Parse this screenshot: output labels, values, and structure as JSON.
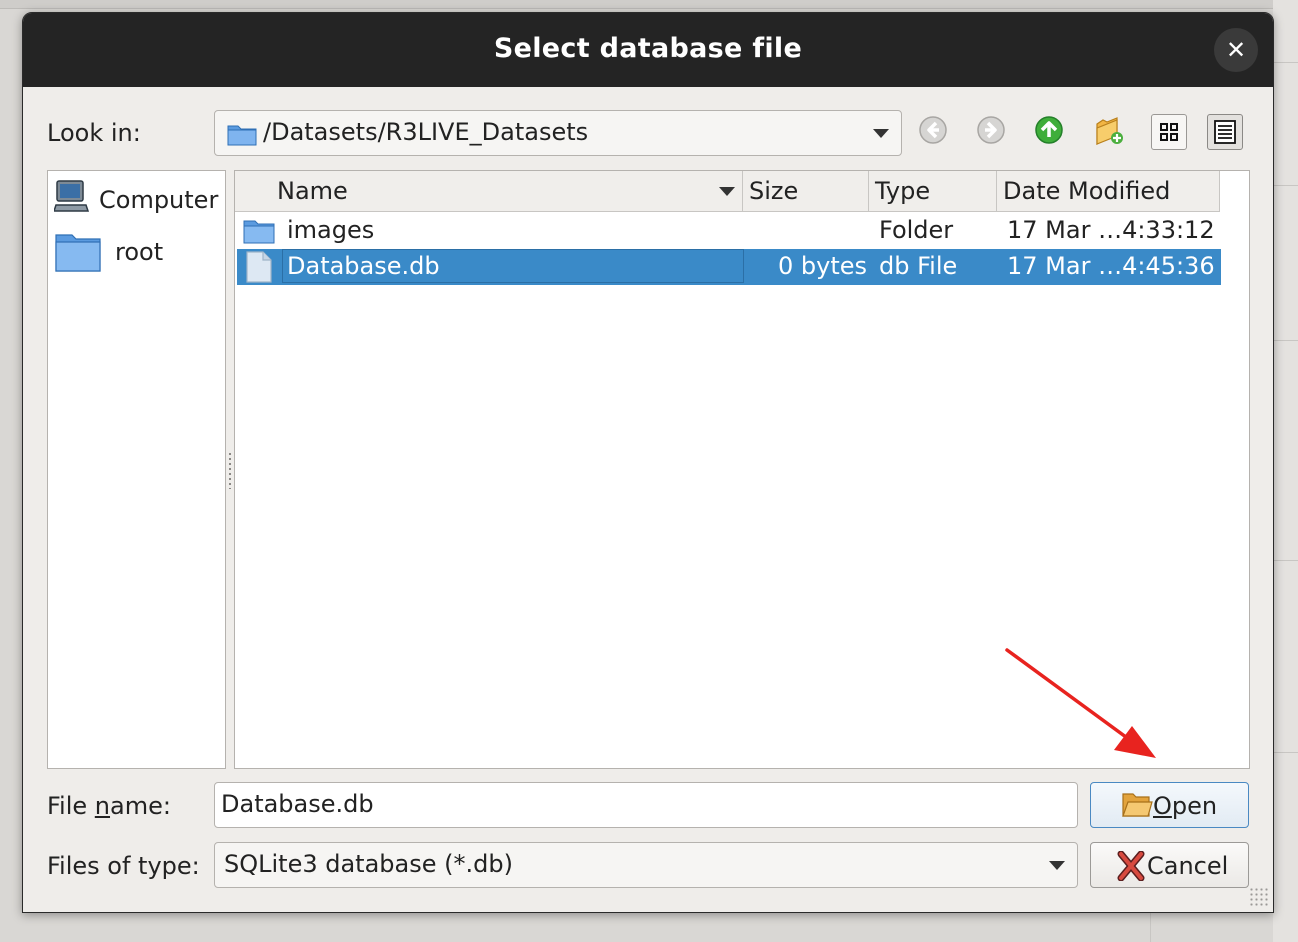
{
  "window": {
    "title": "Select database file",
    "close_glyph": "✕"
  },
  "toolbar": {
    "look_in_label": "Look in:",
    "path": "/Datasets/R3LIVE_Datasets",
    "buttons": [
      "back-icon",
      "forward-icon",
      "parent-directory-icon",
      "new-folder-icon",
      "list-view-icon",
      "detail-view-icon"
    ]
  },
  "sidebar": {
    "items": [
      {
        "label": "Computer",
        "icon": "computer-icon"
      },
      {
        "label": "root",
        "icon": "folder-icon"
      }
    ]
  },
  "file_list": {
    "columns": [
      "Name",
      "Size",
      "Type",
      "Date Modified"
    ],
    "rows": [
      {
        "name": "images",
        "size": "",
        "type": "Folder",
        "date": "17 Mar …4:33:12",
        "icon": "folder-icon",
        "selected": false
      },
      {
        "name": "Database.db",
        "size": "0 bytes",
        "type": "db File",
        "date": "17 Mar …4:45:36",
        "icon": "file-icon",
        "selected": true
      }
    ]
  },
  "footer": {
    "file_name_label_pre": "File ",
    "file_name_label_mnemonic": "n",
    "file_name_label_post": "ame:",
    "file_name_value": "Database.db",
    "files_of_type_label": "Files of type:",
    "files_of_type_value": "SQLite3 database (*.db)",
    "open_label_mnemonic": "O",
    "open_label_rest": "pen",
    "cancel_label": "Cancel"
  },
  "colors": {
    "titlebar": "#242424",
    "selection": "#3a8ac8",
    "annotation_arrow": "#e8231f"
  }
}
